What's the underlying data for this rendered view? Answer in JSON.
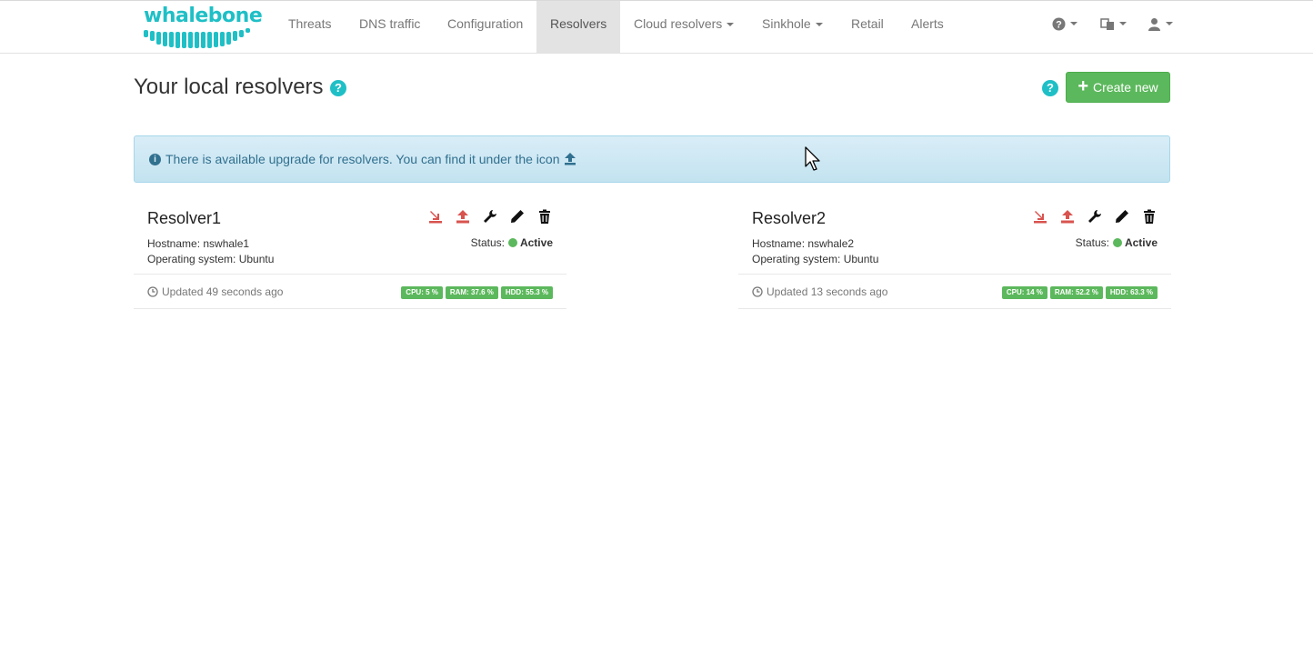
{
  "brand": {
    "name": "whalebone",
    "color": "#1fbfc6"
  },
  "nav": {
    "threats": "Threats",
    "dns_traffic": "DNS traffic",
    "configuration": "Configuration",
    "resolvers": "Resolvers",
    "cloud_resolvers": "Cloud resolvers",
    "sinkhole": "Sinkhole",
    "retail": "Retail",
    "alerts": "Alerts",
    "icons": [
      "question-circle-icon",
      "language-icon",
      "user-icon"
    ]
  },
  "page": {
    "title": "Your local resolvers",
    "help_icon": "?",
    "create_button": "Create new",
    "create_button_color": "#5cb85c"
  },
  "alert": {
    "text": "There is available upgrade for resolvers. You can find it under the icon",
    "icon": "info-circle-icon"
  },
  "resolvers": [
    {
      "name": "Resolver1",
      "hostname": "Hostname: nswhale1",
      "os": "Operating system: Ubuntu",
      "status_label": "Status:",
      "status": "Active",
      "updated": "Updated 49 seconds ago",
      "cpu": "CPU: 5 %",
      "ram": "RAM: 37.6 %",
      "hdd": "HDD: 55.3 %"
    },
    {
      "name": "Resolver2",
      "hostname": "Hostname: nswhale2",
      "os": "Operating system: Ubuntu",
      "status_label": "Status:",
      "status": "Active",
      "updated": "Updated 13 seconds ago",
      "cpu": "CPU: 14 %",
      "ram": "RAM: 52.2 %",
      "hdd": "HDD: 63.3 %"
    }
  ],
  "colors": {
    "danger": "#d9534f",
    "success": "#5cb85c",
    "info_text": "#31708f",
    "info_bg": "#d9edf7"
  }
}
